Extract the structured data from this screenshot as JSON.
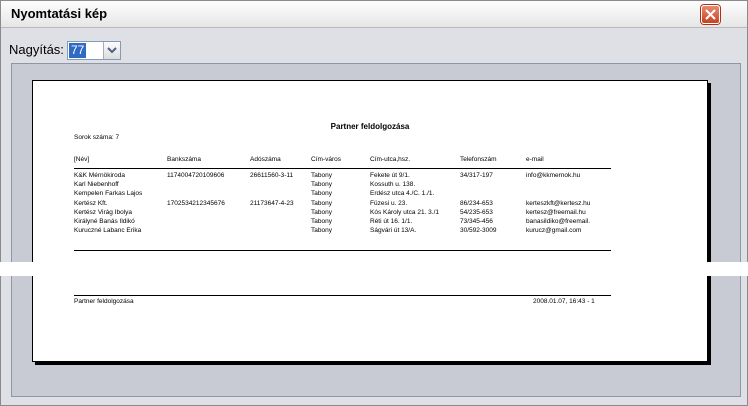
{
  "window": {
    "title": "Nyomtatási kép",
    "close_icon": "close-icon"
  },
  "zoom": {
    "label": "Nagyítás:",
    "value": "77"
  },
  "report": {
    "title": "Partner feldolgozása",
    "row_count": "Sorok száma: 7",
    "columns": [
      "[Név]",
      "Bankszáma",
      "Adószáma",
      "Cím-város",
      "Cím-utca,hsz.",
      "Telefonszám",
      "e-mail"
    ],
    "rows": [
      [
        "K&K Mérnökiroda",
        "1174004720109606",
        "26611560-3-11",
        "Tabony",
        "Fekete út 9/1.",
        "34/317-197",
        "info@kkmernok.hu"
      ],
      [
        "Karl Niebenhoff",
        "",
        "",
        "Tabony",
        "Kossuth u. 138.",
        "",
        ""
      ],
      [
        "Kempelen Farkas Lajos",
        "",
        "",
        "Tabony",
        "Erdész utca 4./C. 1./1.",
        "",
        ""
      ],
      [
        "Kertész Kft.",
        "1702534212345676",
        "21173647-4-23",
        "Tabony",
        "Füzesi u. 23.",
        "86/234-653",
        "kerteszkft@kertesz.hu"
      ],
      [
        "Kertész Virág Ibolya",
        "",
        "",
        "Tabony",
        "Kós Károly utca 21. 3./1",
        "54/235-653",
        "kertesz@freemail.hu"
      ],
      [
        "Királyné Banás Ildikó",
        "",
        "",
        "Tabony",
        "Réti út 16. 1/1.",
        "73/345-456",
        "banasildiko@freemail."
      ],
      [
        "Kuruczné Labanc Erika",
        "",
        "",
        "Tabony",
        "Ságvári út 13/A.",
        "30/592-3009",
        "kurucz@gmail.com"
      ]
    ],
    "footer_left": "Partner feldolgozása",
    "footer_right": "2008.01.07, 16:43 - 1"
  }
}
